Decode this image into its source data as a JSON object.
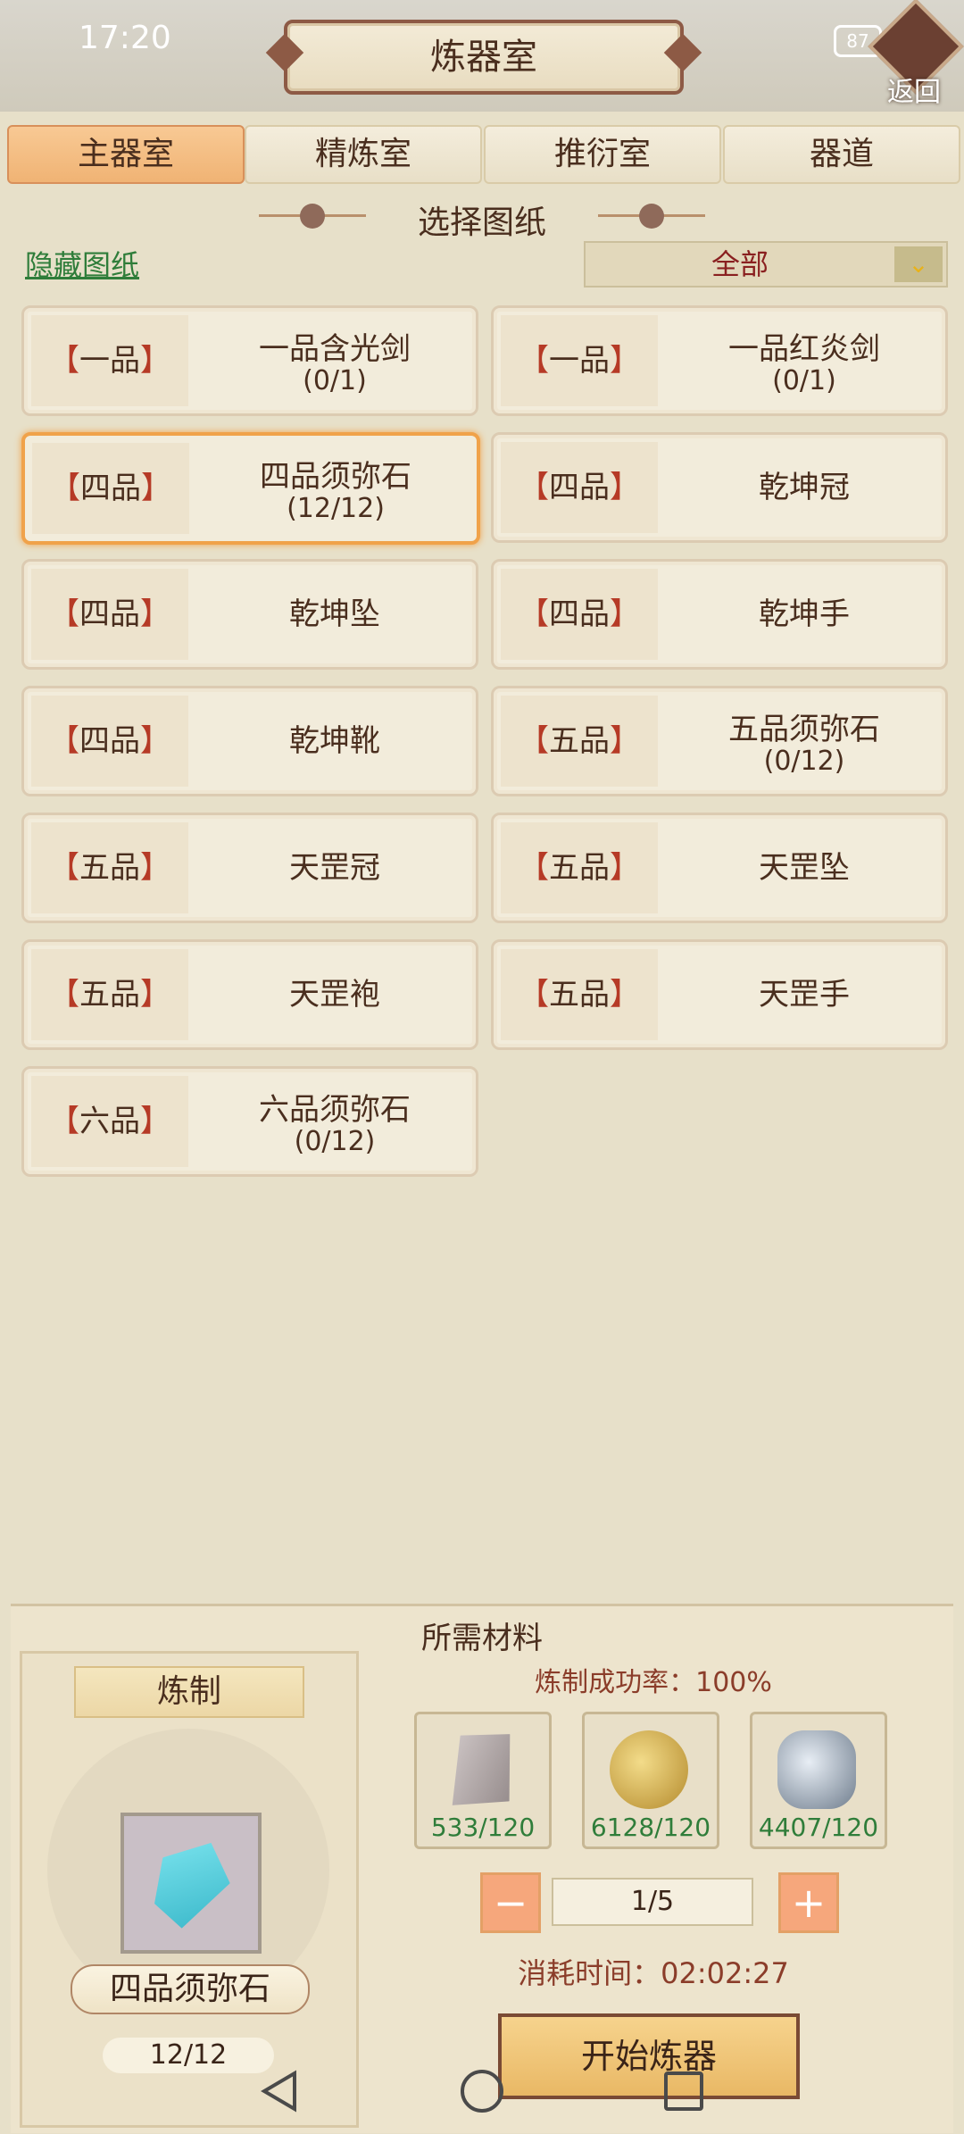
{
  "status_bar": {
    "time": "17:20",
    "battery": "87"
  },
  "header": {
    "title": "炼器室",
    "back_label": "返回"
  },
  "tabs": [
    {
      "label": "主器室",
      "active": true
    },
    {
      "label": "精炼室",
      "active": false
    },
    {
      "label": "推衍室",
      "active": false
    },
    {
      "label": "器道",
      "active": false
    }
  ],
  "section": {
    "title": "选择图纸"
  },
  "hide_link": "隐藏图纸",
  "filter": {
    "selected": "全部",
    "icon": "double-chevron-down-icon"
  },
  "blueprints": [
    {
      "grade": "一品",
      "name": "一品含光剑",
      "count": "(0/1)"
    },
    {
      "grade": "一品",
      "name": "一品红炎剑",
      "count": "(0/1)"
    },
    {
      "grade": "四品",
      "name": "四品须弥石",
      "count": "(12/12)",
      "selected": true
    },
    {
      "grade": "四品",
      "name": "乾坤冠",
      "count": ""
    },
    {
      "grade": "四品",
      "name": "乾坤坠",
      "count": ""
    },
    {
      "grade": "四品",
      "name": "乾坤手",
      "count": ""
    },
    {
      "grade": "四品",
      "name": "乾坤靴",
      "count": ""
    },
    {
      "grade": "五品",
      "name": "五品须弥石",
      "count": "(0/12)"
    },
    {
      "grade": "五品",
      "name": "天罡冠",
      "count": ""
    },
    {
      "grade": "五品",
      "name": "天罡坠",
      "count": ""
    },
    {
      "grade": "五品",
      "name": "天罡袍",
      "count": ""
    },
    {
      "grade": "五品",
      "name": "天罡手",
      "count": ""
    },
    {
      "grade": "六品",
      "name": "六品须弥石",
      "count": "(0/12)"
    }
  ],
  "materials_panel": {
    "title": "所需材料",
    "craft_label": "炼制",
    "item_name": "四品须弥石",
    "item_count": "12/12",
    "success_rate": "炼制成功率：100%",
    "materials": [
      {
        "qty": "533/120",
        "icon": "grey-stone-icon",
        "color": "#a89c9c"
      },
      {
        "qty": "6128/120",
        "icon": "gold-ore-icon",
        "color": "#c9a84a"
      },
      {
        "qty": "4407/120",
        "icon": "silver-ore-icon",
        "color": "#9aa7b6"
      }
    ],
    "stepper_value": "1/5",
    "minus": "−",
    "plus": "+",
    "time_cost": "消耗时间：02:02:27",
    "start_button": "开始炼器"
  }
}
